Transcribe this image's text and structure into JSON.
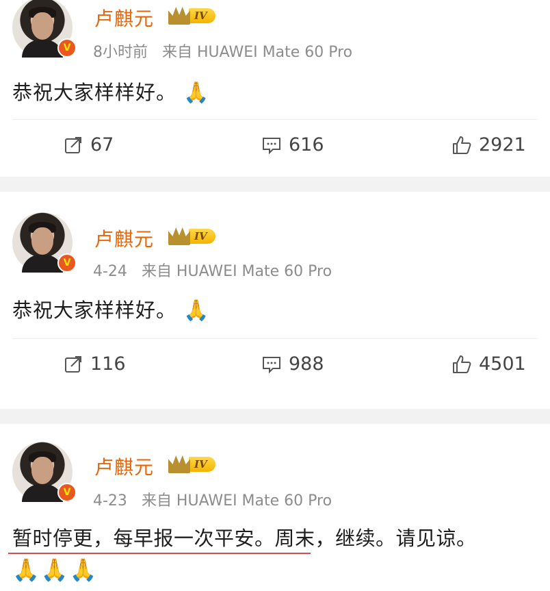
{
  "posts": [
    {
      "author": "卢麒元",
      "level_badge": "IV",
      "verified_mark": "V",
      "time": "8小时前",
      "source": "来自 HUAWEI Mate 60 Pro",
      "text": "恭祝大家样样好。",
      "emoji": "🙏",
      "reposts": "67",
      "comments": "616",
      "likes": "2921"
    },
    {
      "author": "卢麒元",
      "level_badge": "IV",
      "verified_mark": "V",
      "time": "4-24",
      "source": "来自 HUAWEI Mate 60 Pro",
      "text": "恭祝大家样样好。",
      "emoji": "🙏",
      "reposts": "116",
      "comments": "988",
      "likes": "4501"
    },
    {
      "author": "卢麒元",
      "level_badge": "IV",
      "verified_mark": "V",
      "time": "4-23",
      "source": "来自 HUAWEI Mate 60 Pro",
      "text": "暂时停更，每早报一次平安。周末，继续。请见谅。",
      "emoji": "🙏🙏🙏"
    }
  ],
  "colors": {
    "author": "#e8660a",
    "meta": "#8c8c8c",
    "separator": "#f2f2f2",
    "highlight_underline": "#d94a55"
  },
  "icons": [
    "repost-icon",
    "comment-icon",
    "like-icon",
    "crown-icon",
    "verified-icon"
  ]
}
